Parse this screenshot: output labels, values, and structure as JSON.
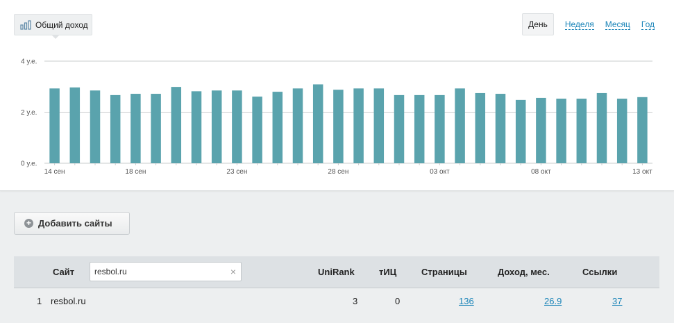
{
  "metric_tab": {
    "label": "Общий доход",
    "icon": "bar-chart-icon"
  },
  "period_tabs": [
    {
      "label": "День",
      "active": true
    },
    {
      "label": "Неделя",
      "active": false
    },
    {
      "label": "Месяц",
      "active": false
    },
    {
      "label": "Год",
      "active": false
    }
  ],
  "chart_data": {
    "type": "bar",
    "ytick_labels": [
      "0 у.е.",
      "2 у.е.",
      "4 у.е."
    ],
    "yticks": [
      0,
      2,
      4
    ],
    "ylim": [
      0,
      4
    ],
    "xtick_labels": [
      "14 сен",
      "18 сен",
      "23 сен",
      "28 сен",
      "03 окт",
      "08 окт",
      "13 окт"
    ],
    "xtick_index": [
      0,
      4,
      9,
      14,
      19,
      24,
      29
    ],
    "categories": [
      "14 сен",
      "15 сен",
      "16 сен",
      "17 сен",
      "18 сен",
      "19 сен",
      "20 сен",
      "21 сен",
      "22 сен",
      "23 сен",
      "24 сен",
      "25 сен",
      "26 сен",
      "27 сен",
      "28 сен",
      "29 сен",
      "30 сен",
      "01 окт",
      "02 окт",
      "03 окт",
      "04 окт",
      "05 окт",
      "06 окт",
      "07 окт",
      "08 окт",
      "09 окт",
      "10 окт",
      "11 окт",
      "12 окт",
      "13 окт"
    ],
    "values": [
      2.93,
      2.97,
      2.85,
      2.67,
      2.72,
      2.72,
      2.99,
      2.82,
      2.85,
      2.85,
      2.61,
      2.8,
      2.93,
      3.09,
      2.88,
      2.93,
      2.93,
      2.67,
      2.67,
      2.67,
      2.93,
      2.75,
      2.72,
      2.48,
      2.56,
      2.53,
      2.53,
      2.75,
      2.53,
      2.59
    ],
    "bar_color": "#5aa3ad",
    "grid": true
  },
  "add_button": {
    "label": "Добавить сайты",
    "icon": "plus-circle-icon"
  },
  "table": {
    "headers": {
      "site": "Сайт",
      "unirank": "UniRank",
      "tic": "тИЦ",
      "pages": "Страницы",
      "income": "Доход, мес.",
      "links": "Ссылки"
    },
    "search": {
      "value": "resbol.ru",
      "placeholder": ""
    },
    "rows": [
      {
        "num": "1",
        "site": "resbol.ru",
        "unirank": "3",
        "tic": "0",
        "pages": "136",
        "income": "26.9",
        "links": "37"
      }
    ]
  },
  "colors": {
    "accent": "#1a84b8",
    "bar": "#5aa3ad",
    "header_bg": "#dde1e4",
    "page_bg": "#edeff0"
  }
}
